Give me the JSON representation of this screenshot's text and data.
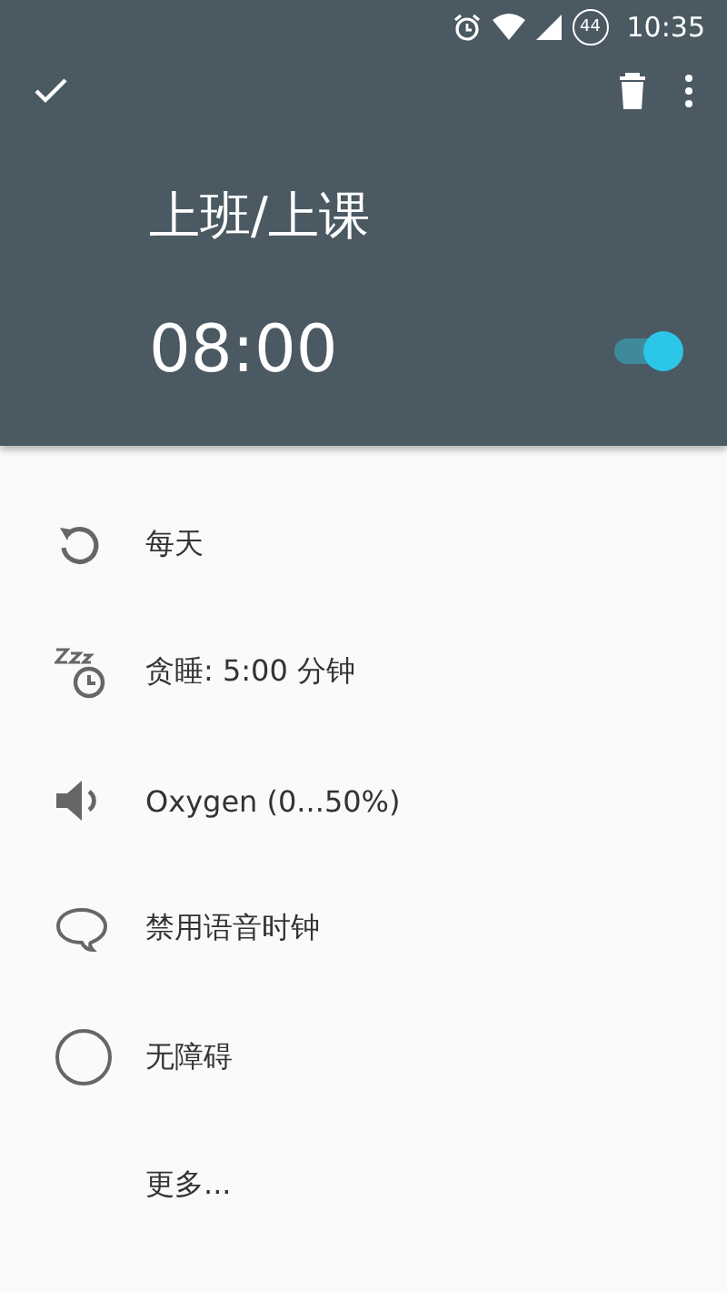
{
  "status_bar": {
    "battery": "44",
    "time": "10:35"
  },
  "alarm": {
    "label": "上班/上课",
    "time": "08:00",
    "on": true
  },
  "options": [
    {
      "kind": "repeat",
      "text": "每天"
    },
    {
      "kind": "snooze",
      "text": "贪睡: 5:00 分钟"
    },
    {
      "kind": "sound",
      "text": "Oxygen (0...50%)"
    },
    {
      "kind": "speech",
      "text": "禁用语音时钟"
    },
    {
      "kind": "circle",
      "text": "无障碍"
    },
    {
      "kind": "more",
      "text": "更多..."
    }
  ]
}
